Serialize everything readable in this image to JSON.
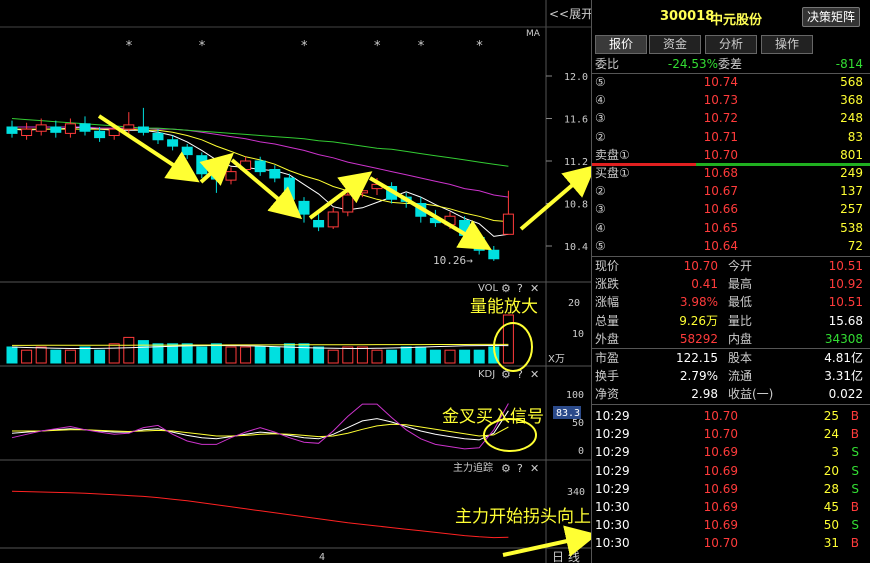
{
  "chart": {
    "expand_label": "<<展开",
    "ma_label": "MA",
    "price_ticks": [
      "12.0",
      "11.6",
      "11.2",
      "10.8",
      "10.4"
    ],
    "low_label": "10.26→",
    "vol_title": "VOL",
    "vol_ticks": [
      "20",
      "10"
    ],
    "vol_unit": "X万",
    "kdj_title": "KDJ",
    "kdj_ticks": [
      "100",
      "50",
      "0"
    ],
    "kdj_value": "83.3",
    "zhuli_title": "主力追踪",
    "zhuli_ticks": [
      "340",
      "330"
    ],
    "x_tick": "4",
    "period_label": "日 线",
    "star_glyph": "*",
    "annotations": [
      "量能放大",
      "金叉买入信号",
      "主力开始拐头向上"
    ]
  },
  "stock": {
    "code": "300018",
    "name": "中元股份",
    "decision_btn": "决策矩阵"
  },
  "tabs": [
    "报价",
    "资金",
    "分析",
    "操作"
  ],
  "weibi": {
    "label1": "委比",
    "value1": "-24.53%",
    "label2": "委差",
    "value2": "-814"
  },
  "sell": [
    {
      "label": "⑤",
      "price": "10.74",
      "vol": "568"
    },
    {
      "label": "④",
      "price": "10.73",
      "vol": "368"
    },
    {
      "label": "③",
      "price": "10.72",
      "vol": "248"
    },
    {
      "label": "②",
      "price": "10.71",
      "vol": "83"
    },
    {
      "label": "卖盘①",
      "price": "10.70",
      "vol": "801"
    }
  ],
  "buy": [
    {
      "label": "买盘①",
      "price": "10.68",
      "vol": "249"
    },
    {
      "label": "②",
      "price": "10.67",
      "vol": "137"
    },
    {
      "label": "③",
      "price": "10.66",
      "vol": "257"
    },
    {
      "label": "④",
      "price": "10.65",
      "vol": "538"
    },
    {
      "label": "⑤",
      "price": "10.64",
      "vol": "72"
    }
  ],
  "stats": [
    {
      "l1": "现价",
      "v1": "10.70",
      "c1": "red",
      "l2": "今开",
      "v2": "10.51",
      "c2": "red"
    },
    {
      "l1": "涨跌",
      "v1": "0.41",
      "c1": "red",
      "l2": "最高",
      "v2": "10.92",
      "c2": "red"
    },
    {
      "l1": "涨幅",
      "v1": "3.98%",
      "c1": "red",
      "l2": "最低",
      "v2": "10.51",
      "c2": "red"
    },
    {
      "l1": "总量",
      "v1": "9.26万",
      "c1": "yellow",
      "l2": "量比",
      "v2": "15.68",
      "c2": "white"
    },
    {
      "l1": "外盘",
      "v1": "58292",
      "c1": "red",
      "l2": "内盘",
      "v2": "34308",
      "c2": "green"
    }
  ],
  "fundamentals": [
    {
      "l1": "市盈",
      "v1": "122.15",
      "l2": "股本",
      "v2": "4.81亿"
    },
    {
      "l1": "换手",
      "v1": "2.79%",
      "l2": "流通",
      "v2": "3.31亿"
    },
    {
      "l1": "净资",
      "v1": "2.98",
      "l2": "收益(一)",
      "v2": "0.022"
    }
  ],
  "ticks": [
    {
      "time": "10:29",
      "price": "10.70",
      "pc": "red",
      "vol": "25",
      "side": "B",
      "sc": "red"
    },
    {
      "time": "10:29",
      "price": "10.70",
      "pc": "red",
      "vol": "24",
      "side": "B",
      "sc": "red"
    },
    {
      "time": "10:29",
      "price": "10.69",
      "pc": "red",
      "vol": "3",
      "side": "S",
      "sc": "green"
    },
    {
      "time": "10:29",
      "price": "10.69",
      "pc": "red",
      "vol": "20",
      "side": "S",
      "sc": "green"
    },
    {
      "time": "10:29",
      "price": "10.69",
      "pc": "red",
      "vol": "28",
      "side": "S",
      "sc": "green"
    },
    {
      "time": "10:30",
      "price": "10.69",
      "pc": "red",
      "vol": "45",
      "side": "B",
      "sc": "red"
    },
    {
      "time": "10:30",
      "price": "10.69",
      "pc": "red",
      "vol": "50",
      "side": "S",
      "sc": "green"
    },
    {
      "time": "10:30",
      "price": "10.70",
      "pc": "red",
      "vol": "31",
      "side": "B",
      "sc": "red"
    }
  ],
  "candles": [
    [
      11.52,
      11.46,
      11.58,
      11.42
    ],
    [
      11.44,
      11.5,
      11.56,
      11.4
    ],
    [
      11.48,
      11.54,
      11.6,
      11.44
    ],
    [
      11.52,
      11.47,
      11.58,
      11.42
    ],
    [
      11.46,
      11.55,
      11.6,
      11.42
    ],
    [
      11.55,
      11.48,
      11.62,
      11.44
    ],
    [
      11.48,
      11.42,
      11.52,
      11.38
    ],
    [
      11.44,
      11.5,
      11.55,
      11.4
    ],
    [
      11.5,
      11.54,
      11.66,
      11.46
    ],
    [
      11.52,
      11.47,
      11.7,
      11.44
    ],
    [
      11.46,
      11.4,
      11.5,
      11.36
    ],
    [
      11.4,
      11.34,
      11.44,
      11.3
    ],
    [
      11.33,
      11.26,
      11.36,
      11.22
    ],
    [
      11.25,
      11.08,
      11.28,
      11.04
    ],
    [
      11.06,
      11.03,
      11.12,
      10.9
    ],
    [
      11.02,
      11.1,
      11.14,
      10.98
    ],
    [
      11.12,
      11.2,
      11.24,
      11.08
    ],
    [
      11.2,
      11.1,
      11.24,
      11.06
    ],
    [
      11.12,
      11.04,
      11.16,
      11.0
    ],
    [
      11.04,
      10.84,
      11.08,
      10.8
    ],
    [
      10.82,
      10.7,
      10.86,
      10.62
    ],
    [
      10.64,
      10.58,
      10.7,
      10.54
    ],
    [
      10.58,
      10.72,
      10.76,
      10.56
    ],
    [
      10.72,
      10.88,
      10.92,
      10.68
    ],
    [
      10.9,
      10.92,
      11.0,
      10.86
    ],
    [
      10.94,
      10.98,
      11.04,
      10.88
    ],
    [
      10.96,
      10.84,
      11.0,
      10.8
    ],
    [
      10.86,
      10.82,
      10.9,
      10.76
    ],
    [
      10.8,
      10.68,
      10.86,
      10.62
    ],
    [
      10.66,
      10.62,
      10.74,
      10.58
    ],
    [
      10.6,
      10.68,
      10.72,
      10.56
    ],
    [
      10.64,
      10.5,
      10.68,
      10.46
    ],
    [
      10.48,
      10.36,
      10.52,
      10.32
    ],
    [
      10.36,
      10.28,
      10.4,
      10.26
    ],
    [
      10.51,
      10.7,
      10.92,
      10.51
    ]
  ],
  "volumes": [
    5,
    4,
    5,
    4,
    4,
    5,
    4,
    6,
    8,
    7,
    6,
    6,
    6,
    5,
    6,
    5,
    5,
    5,
    5,
    6,
    6,
    5,
    4,
    5,
    5,
    4,
    4,
    5,
    5,
    4,
    4,
    4,
    4,
    5,
    15
  ],
  "ma_lines": {
    "ma5": [
      11.5,
      11.49,
      11.5,
      11.5,
      11.51,
      11.52,
      11.5,
      11.49,
      11.49,
      11.49,
      11.47,
      11.44,
      11.38,
      11.3,
      11.21,
      11.15,
      11.14,
      11.12,
      11.11,
      11.07,
      10.98,
      10.89,
      10.77,
      10.74,
      10.76,
      10.81,
      10.86,
      10.91,
      10.86,
      10.79,
      10.73,
      10.66,
      10.61,
      10.49,
      10.51
    ],
    "ma10": [
      11.5,
      11.5,
      11.5,
      11.5,
      11.5,
      11.5,
      11.5,
      11.5,
      11.5,
      11.49,
      11.49,
      11.47,
      11.44,
      11.4,
      11.34,
      11.29,
      11.24,
      11.21,
      11.17,
      11.11,
      11.06,
      11.02,
      10.96,
      10.92,
      10.88,
      10.84,
      10.81,
      10.8,
      10.8,
      10.78,
      10.75,
      10.71,
      10.68,
      10.64,
      10.63
    ],
    "ma20": [
      11.52,
      11.52,
      11.52,
      11.52,
      11.52,
      11.52,
      11.51,
      11.51,
      11.51,
      11.51,
      11.5,
      11.5,
      11.49,
      11.47,
      11.45,
      11.43,
      11.41,
      11.38,
      11.36,
      11.33,
      11.3,
      11.26,
      11.23,
      11.19,
      11.16,
      11.13,
      11.1,
      11.07,
      11.04,
      11.01,
      10.98,
      10.94,
      10.92,
      10.88,
      10.86
    ],
    "ma30": [
      11.6,
      11.59,
      11.58,
      11.57,
      11.56,
      11.55,
      11.54,
      11.53,
      11.52,
      11.51,
      11.51,
      11.5,
      11.49,
      11.48,
      11.47,
      11.46,
      11.45,
      11.44,
      11.43,
      11.42,
      11.41,
      11.39,
      11.38,
      11.36,
      11.34,
      11.32,
      11.31,
      11.29,
      11.27,
      11.25,
      11.23,
      11.21,
      11.19,
      11.17,
      11.15
    ]
  },
  "kdj": {
    "k": [
      30,
      32,
      34,
      36,
      38,
      36,
      34,
      32,
      32,
      36,
      38,
      32,
      26,
      22,
      20,
      24,
      28,
      32,
      30,
      26,
      22,
      20,
      28,
      40,
      52,
      56,
      50,
      42,
      34,
      28,
      24,
      20,
      18,
      30,
      70
    ],
    "d": [
      34,
      34,
      34,
      35,
      36,
      36,
      35,
      34,
      33,
      34,
      35,
      34,
      31,
      28,
      25,
      25,
      26,
      28,
      29,
      28,
      26,
      24,
      25,
      30,
      37,
      43,
      46,
      45,
      41,
      37,
      33,
      29,
      25,
      27,
      41
    ],
    "j": [
      22,
      28,
      34,
      38,
      42,
      36,
      32,
      28,
      30,
      40,
      44,
      28,
      16,
      10,
      10,
      22,
      32,
      40,
      32,
      22,
      14,
      12,
      34,
      60,
      82,
      82,
      58,
      36,
      20,
      10,
      6,
      2,
      4,
      36,
      83
    ]
  },
  "zhuli": [
    341.2,
    341.1,
    341.0,
    340.9,
    340.8,
    340.7,
    340.5,
    340.3,
    340.1,
    339.9,
    339.6,
    339.2,
    338.8,
    338.3,
    337.8,
    337.3,
    336.8,
    336.3,
    335.8,
    335.3,
    334.8,
    334.3,
    333.8,
    333.3,
    332.9,
    332.5,
    332.1,
    331.7,
    331.3,
    330.9,
    330.5,
    330.1,
    329.8,
    329.6,
    329.7
  ]
}
